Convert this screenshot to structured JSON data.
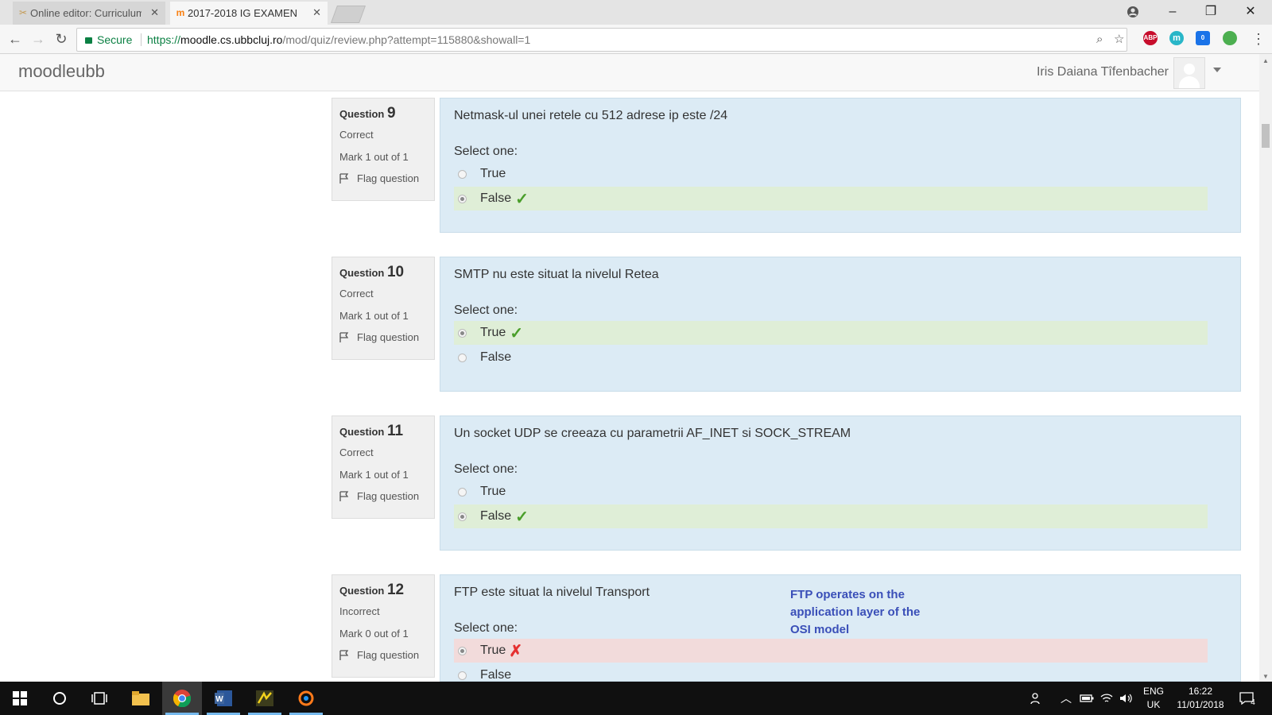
{
  "browser": {
    "tabs": [
      {
        "title": "Online editor: Curriculum",
        "active": false,
        "favicon": "editor-icon"
      },
      {
        "title": "2017-2018 IG EXAMEN",
        "active": true,
        "favicon": "moodle-icon"
      }
    ],
    "security_label": "Secure",
    "url": {
      "scheme": "https://",
      "host": "moodle.cs.ubbcluj.ro",
      "path": "/mod/quiz/review.php?attempt=115880&showall=1"
    },
    "extensions": [
      {
        "name": "adblock-plus-icon",
        "label": "ABP",
        "color": "#c70d2c"
      },
      {
        "name": "extension-m-icon",
        "label": "m",
        "color": "#29b6c8"
      },
      {
        "name": "extension-badge-icon",
        "label": "0",
        "color": "#1a73e8"
      },
      {
        "name": "globe-extension-icon",
        "label": "",
        "color": "#4caf50"
      }
    ]
  },
  "moodle": {
    "brand": "moodleubb",
    "user_name": "Iris Daiana Tîfenbacher"
  },
  "questions": [
    {
      "label": "Question",
      "number": "9",
      "state": "Correct",
      "grade": "Mark 1 out of 1",
      "flag": "Flag question",
      "text": "Netmask-ul unei retele cu 512 adrese ip este /24",
      "prompt": "Select one:",
      "answers": [
        {
          "label": "True",
          "selected": false,
          "result": "none"
        },
        {
          "label": "False",
          "selected": true,
          "result": "correct"
        }
      ]
    },
    {
      "label": "Question",
      "number": "10",
      "state": "Correct",
      "grade": "Mark 1 out of 1",
      "flag": "Flag question",
      "text": "SMTP nu este situat la nivelul Retea",
      "prompt": "Select one:",
      "answers": [
        {
          "label": "True",
          "selected": true,
          "result": "correct"
        },
        {
          "label": "False",
          "selected": false,
          "result": "none"
        }
      ]
    },
    {
      "label": "Question",
      "number": "11",
      "state": "Correct",
      "grade": "Mark 1 out of 1",
      "flag": "Flag question",
      "text": "Un socket UDP se creeaza cu parametrii AF_INET si SOCK_STREAM",
      "prompt": "Select one:",
      "answers": [
        {
          "label": "True",
          "selected": false,
          "result": "none"
        },
        {
          "label": "False",
          "selected": true,
          "result": "correct"
        }
      ]
    },
    {
      "label": "Question",
      "number": "12",
      "state": "Incorrect",
      "grade": "Mark 0 out of 1",
      "flag": "Flag question",
      "text": "FTP este situat la nivelul Transport",
      "prompt": "Select one:",
      "answers": [
        {
          "label": "True",
          "selected": true,
          "result": "incorrect"
        },
        {
          "label": "False",
          "selected": false,
          "result": "none"
        }
      ]
    }
  ],
  "annotation": {
    "lines": [
      "FTP operates on the",
      "application layer of the",
      "OSI model"
    ],
    "color": "#3a4fb8"
  },
  "colors": {
    "correct_bg": "#dfeed7",
    "incorrect_bg": "#f2dbdb",
    "formulation_bg": "#dcebf5",
    "check_color": "#4a9e2a",
    "cross_color": "#e53030"
  },
  "taskbar": {
    "pinned": [
      "windows-start-icon",
      "cortana-search-icon",
      "task-view-icon",
      "file-explorer-icon",
      "chrome-icon",
      "word-icon",
      "ide-app-icon",
      "sync-app-icon"
    ],
    "language_top": "ENG",
    "language_bottom": "UK",
    "time": "16:22",
    "date": "11/01/2018",
    "notification_count": "4"
  }
}
